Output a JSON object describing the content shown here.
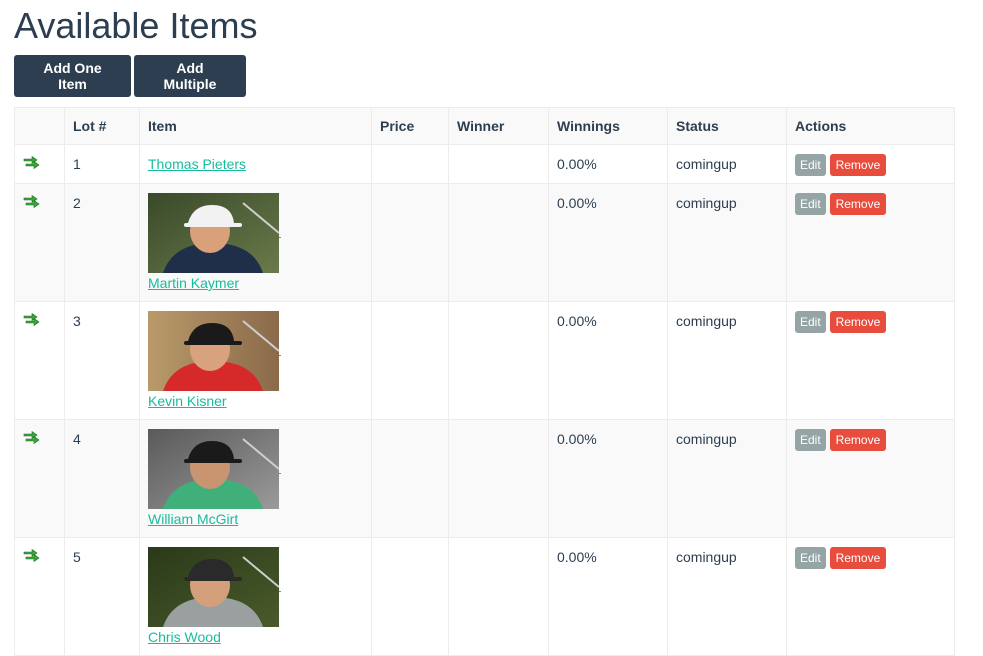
{
  "page": {
    "title": "Available Items"
  },
  "toolbar": {
    "add_one_label": "Add One Item",
    "add_multiple_label": "Add Multiple"
  },
  "table": {
    "headers": [
      "",
      "Lot #",
      "Item",
      "Price",
      "Winner",
      "Winnings",
      "Status",
      "Actions"
    ],
    "rows": [
      {
        "lot": "1",
        "item": "Thomas Pieters",
        "price": "",
        "winner": "",
        "winnings": "0.00%",
        "status": "comingup",
        "has_photo": false
      },
      {
        "lot": "2",
        "item": "Martin Kaymer",
        "price": "",
        "winner": "",
        "winnings": "0.00%",
        "status": "comingup",
        "has_photo": true
      },
      {
        "lot": "3",
        "item": "Kevin Kisner",
        "price": "",
        "winner": "",
        "winnings": "0.00%",
        "status": "comingup",
        "has_photo": true
      },
      {
        "lot": "4",
        "item": "William McGirt",
        "price": "",
        "winner": "",
        "winnings": "0.00%",
        "status": "comingup",
        "has_photo": true
      },
      {
        "lot": "5",
        "item": "Chris Wood",
        "price": "",
        "winner": "",
        "winnings": "0.00%",
        "status": "comingup",
        "has_photo": true
      }
    ],
    "actions": {
      "edit_label": "Edit",
      "remove_label": "Remove"
    }
  },
  "icons": {
    "row_move": "move-arrows-icon"
  },
  "colors": {
    "primary": "#2c3e50",
    "link": "#18bc9c",
    "edit": "#95a5a6",
    "remove": "#e74c3c",
    "icon_green": "#3aa63a"
  }
}
